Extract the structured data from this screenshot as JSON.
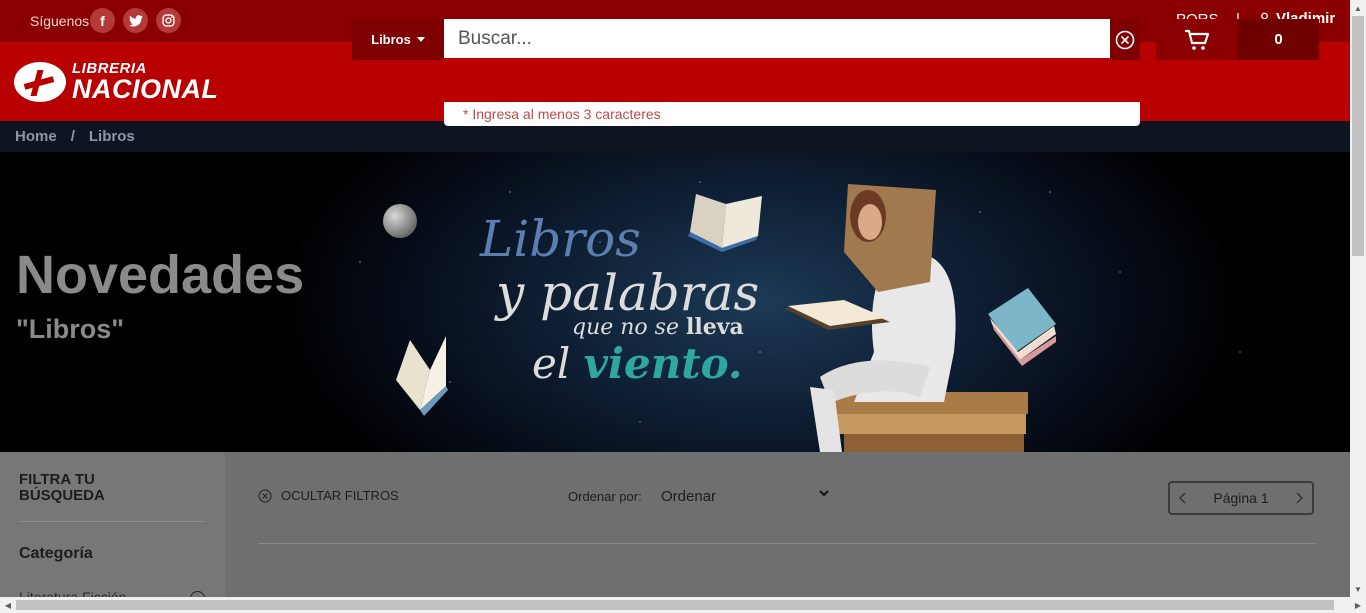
{
  "topbar": {
    "follow_label": "Síguenos",
    "social": [
      {
        "icon": "facebook-icon",
        "glyph": "f"
      },
      {
        "icon": "twitter-icon",
        "glyph": "t"
      },
      {
        "icon": "instagram-icon",
        "glyph": "ig"
      }
    ],
    "pqrs_label": "PQRS",
    "separator": "|",
    "user_name": "Vladimir"
  },
  "header": {
    "logo_line1": "LIBRERIA",
    "logo_line2": "NACIONAL",
    "category_label": "Libros",
    "search_placeholder": "Buscar...",
    "search_hint": "* Ingresa al menos 3 caracteres",
    "cart_count": "0"
  },
  "breadcrumb": {
    "home": "Home",
    "separator": "/",
    "current": "Libros"
  },
  "banner": {
    "title": "Novedades",
    "subtitle": "\"Libros\"",
    "slogan_1": "Libros",
    "slogan_2": "y palabras",
    "slogan_3a": "que no se ",
    "slogan_3b": "lleva",
    "slogan_4a": "el ",
    "slogan_4b": "viento."
  },
  "filters": {
    "title": "FILTRA TU BÚSQUEDA",
    "category_heading": "Categoría",
    "first_category": "Literatura Ficción"
  },
  "toolbar": {
    "hide_filters": "OCULTAR FILTROS",
    "order_label": "Ordenar por:",
    "order_value": "Ordenar",
    "page_label": "Página 1"
  },
  "colors": {
    "topbar": "#8a0000",
    "header": "#b80000",
    "accent_dark": "#7f0000",
    "teal": "#2ea7a1"
  }
}
